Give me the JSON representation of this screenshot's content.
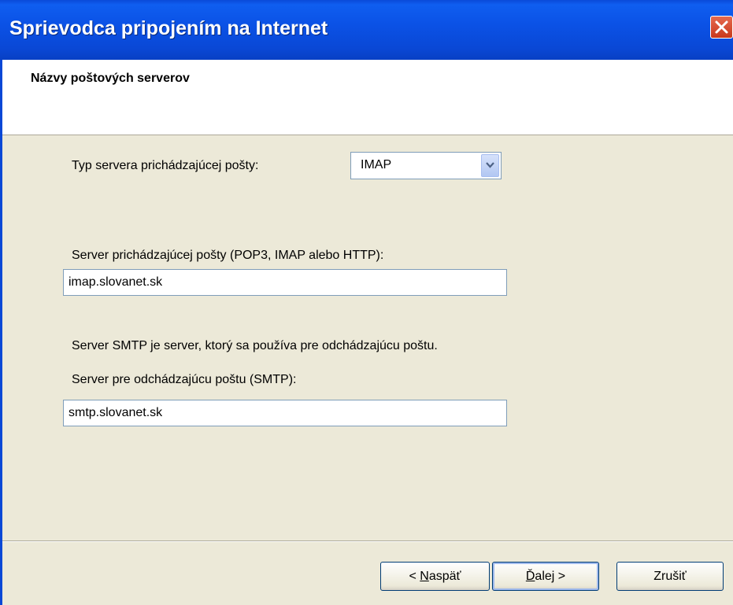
{
  "window": {
    "title": "Sprievodca pripojením na Internet",
    "close_icon": "close-icon"
  },
  "header": {
    "title": "Názvy poštových serverov"
  },
  "form": {
    "incoming_type_label": "Typ servera prichádzajúcej pošty:",
    "incoming_type_value": "IMAP",
    "incoming_server_label": "Server prichádzajúcej pošty (POP3, IMAP alebo HTTP):",
    "incoming_server_value": "imap.slovanet.sk",
    "smtp_info": "Server SMTP je server, ktorý sa používa pre odchádzajúcu poštu.",
    "outgoing_server_label": "Server pre odchádzajúcu poštu (SMTP):",
    "outgoing_server_value": "smtp.slovanet.sk"
  },
  "buttons": {
    "back_prefix": "< ",
    "back_underlined": "N",
    "back_rest": "aspäť",
    "next_underlined": "Ď",
    "next_rest": "alej >",
    "cancel": "Zrušiť"
  },
  "colors": {
    "titlebar": "#0a4ad8",
    "close_button": "#e05a3c",
    "dialog_bg": "#ece9d8"
  }
}
